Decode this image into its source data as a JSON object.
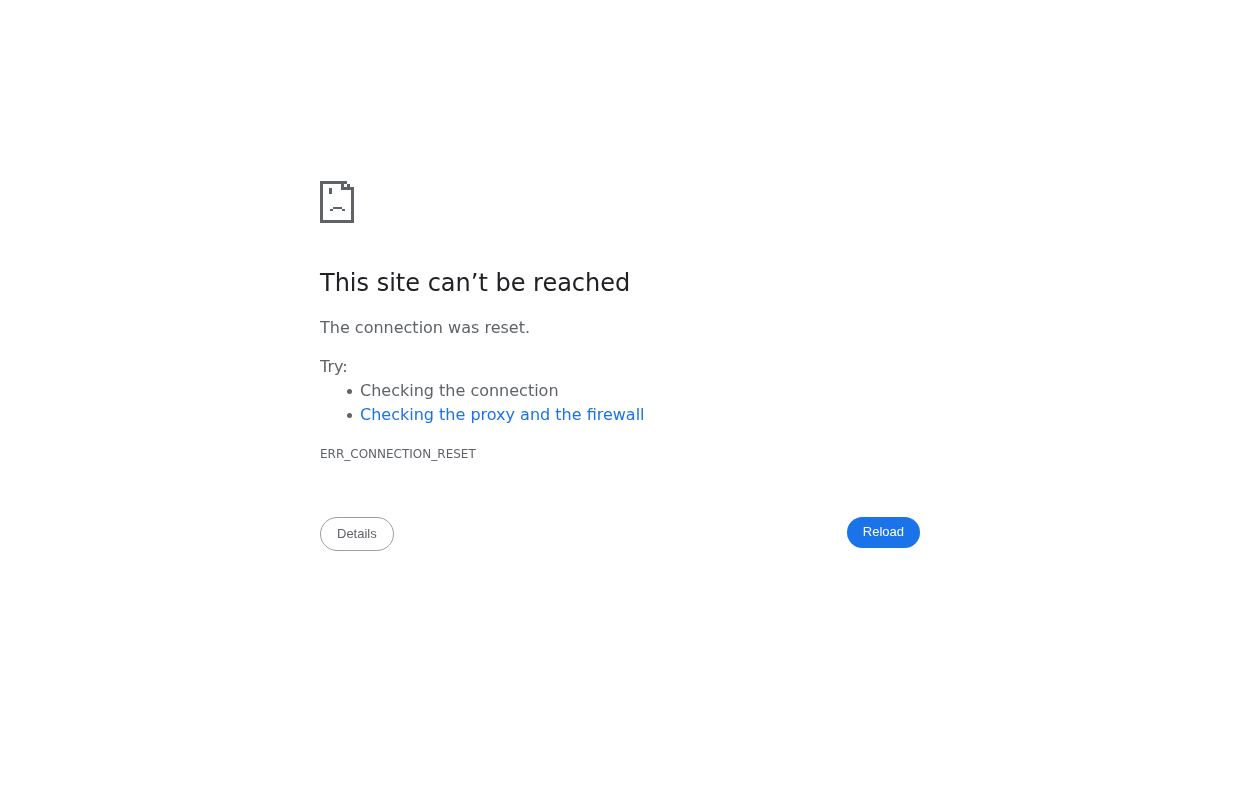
{
  "heading": "This site can’t be reached",
  "message": "The connection was reset.",
  "suggestions": {
    "label": "Try:",
    "items": [
      {
        "kind": "text",
        "text": "Checking the connection"
      },
      {
        "kind": "link",
        "text": "Checking the proxy and the firewall"
      }
    ]
  },
  "error_code": "ERR_CONNECTION_RESET",
  "buttons": [
    {
      "kind": "secondary",
      "label": "Details"
    },
    {
      "kind": "primary",
      "label": "Reload"
    }
  ]
}
